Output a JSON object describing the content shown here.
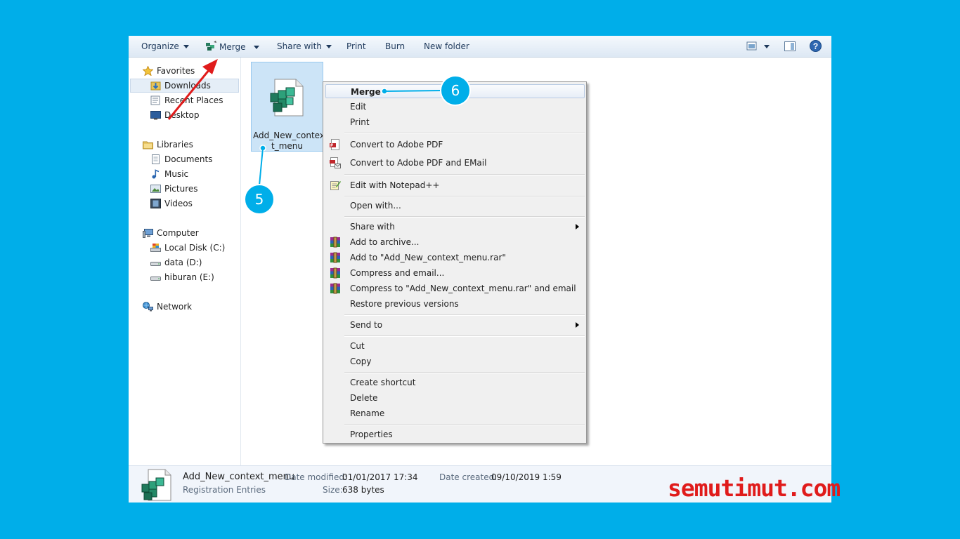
{
  "toolbar": {
    "organize": "Organize",
    "merge": "Merge",
    "share_with": "Share with",
    "print": "Print",
    "burn": "Burn",
    "new_folder": "New folder",
    "icons": [
      "merge-icon",
      "view-icon",
      "preview-pane-icon",
      "help-icon"
    ]
  },
  "nav": {
    "favorites": "Favorites",
    "downloads": "Downloads",
    "recent_places": "Recent Places",
    "desktop": "Desktop",
    "libraries": "Libraries",
    "documents": "Documents",
    "music": "Music",
    "pictures": "Pictures",
    "videos": "Videos",
    "computer": "Computer",
    "local_disk": "Local Disk (C:)",
    "data": "data (D:)",
    "hiburan": "hiburan (E:)",
    "network": "Network"
  },
  "file": {
    "name_line1": "Add_New_contex",
    "name_line2": "t_menu"
  },
  "context_menu": {
    "merge": "Merge",
    "edit": "Edit",
    "print": "Print",
    "convert_pdf": "Convert to Adobe PDF",
    "convert_pdf_email": "Convert to Adobe PDF and EMail",
    "edit_notepad": "Edit with Notepad++",
    "open_with": "Open with...",
    "share_with": "Share with",
    "add_archive": "Add to archive...",
    "add_rar": "Add to \"Add_New_context_menu.rar\"",
    "compress_email": "Compress and email...",
    "compress_rar_email": "Compress to \"Add_New_context_menu.rar\" and email",
    "restore": "Restore previous versions",
    "send_to": "Send to",
    "cut": "Cut",
    "copy": "Copy",
    "create_shortcut": "Create shortcut",
    "delete": "Delete",
    "rename": "Rename",
    "properties": "Properties"
  },
  "status": {
    "name": "Add_New_context_menu",
    "type": "Registration Entries",
    "modified_label": "Date modified:",
    "modified_value": "01/01/2017 17:34",
    "size_label": "Size:",
    "size_value": "638 bytes",
    "created_label": "Date created:",
    "created_value": "09/10/2019 1:59"
  },
  "annotations": {
    "step5": "5",
    "step6": "6",
    "badge_color": "#00aee9",
    "arrow_color": "#e01b1b"
  },
  "watermark": "semutimut.com",
  "colors": {
    "background": "#00aee9",
    "selection": "#cce4f7",
    "toolbar_text": "#1e395b"
  }
}
